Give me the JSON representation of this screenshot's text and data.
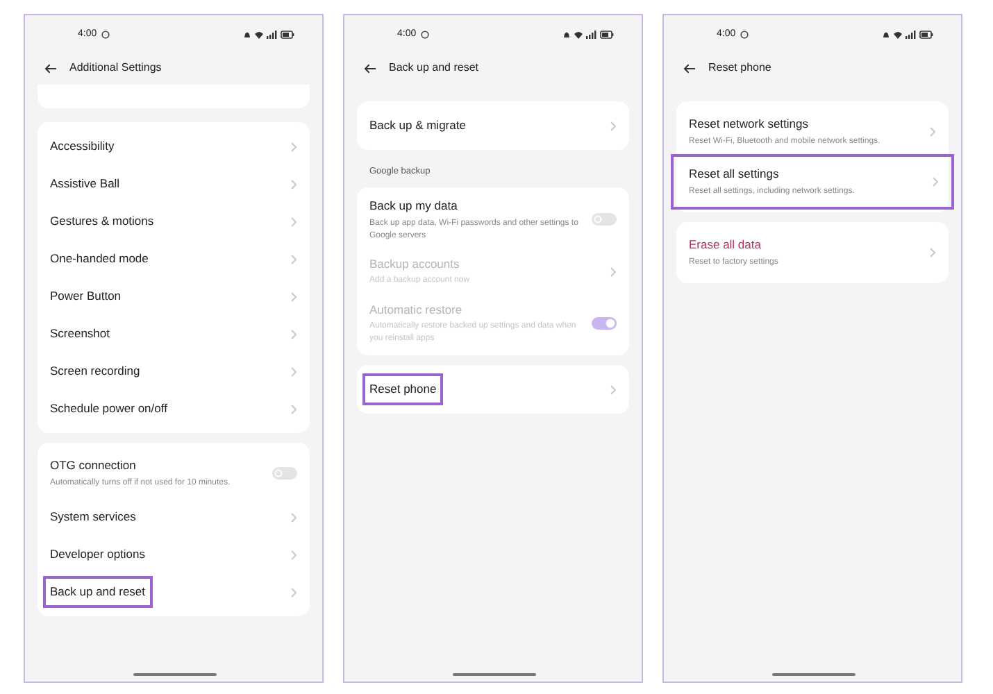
{
  "screens": [
    {
      "time": "4:00",
      "title": "Additional Settings",
      "top_cut_card": true,
      "groups": [
        {
          "items": [
            {
              "kind": "nav",
              "title": "Accessibility"
            },
            {
              "kind": "nav",
              "title": "Assistive Ball"
            },
            {
              "kind": "nav",
              "title": "Gestures & motions"
            },
            {
              "kind": "nav",
              "title": "One-handed mode"
            },
            {
              "kind": "nav",
              "title": "Power Button"
            },
            {
              "kind": "nav",
              "title": "Screenshot"
            },
            {
              "kind": "nav",
              "title": "Screen recording"
            },
            {
              "kind": "nav",
              "title": "Schedule power on/off"
            }
          ]
        },
        {
          "items": [
            {
              "kind": "toggle",
              "title": "OTG connection",
              "subtitle": "Automatically turns off if not used for 10 minutes.",
              "on": false
            },
            {
              "kind": "nav",
              "title": "System services"
            },
            {
              "kind": "nav",
              "title": "Developer options"
            },
            {
              "kind": "nav",
              "title": "Back up and reset",
              "highlighted": true
            }
          ]
        }
      ]
    },
    {
      "time": "4:00",
      "title": "Back up and reset",
      "top_cut_card": false,
      "groups": [
        {
          "items": [
            {
              "kind": "nav",
              "title": "Back up & migrate"
            }
          ]
        },
        {
          "header": "Google backup",
          "items": [
            {
              "kind": "toggle",
              "title": "Back up my data",
              "subtitle": "Back up app data, Wi-Fi passwords and other settings to Google servers",
              "on": false
            },
            {
              "kind": "nav",
              "title": "Backup accounts",
              "subtitle": "Add a backup account now",
              "disabled": true
            },
            {
              "kind": "toggle",
              "title": "Automatic restore",
              "subtitle": "Automatically restore backed up settings and data when you reinstall apps",
              "on": true,
              "disabled": true
            }
          ]
        },
        {
          "items": [
            {
              "kind": "nav",
              "title": "Reset phone",
              "highlighted": true
            }
          ]
        }
      ]
    },
    {
      "time": "4:00",
      "title": "Reset phone",
      "top_cut_card": false,
      "groups": [
        {
          "items": [
            {
              "kind": "nav",
              "title": "Reset network settings",
              "subtitle": "Reset Wi-Fi, Bluetooth and mobile network settings."
            },
            {
              "kind": "nav",
              "title": "Reset all settings",
              "subtitle": "Reset all settings, including network settings.",
              "highlighted": true
            }
          ]
        },
        {
          "items": [
            {
              "kind": "nav",
              "title": "Erase all data",
              "subtitle": "Reset to factory settings",
              "destructive": true
            }
          ]
        }
      ]
    }
  ]
}
